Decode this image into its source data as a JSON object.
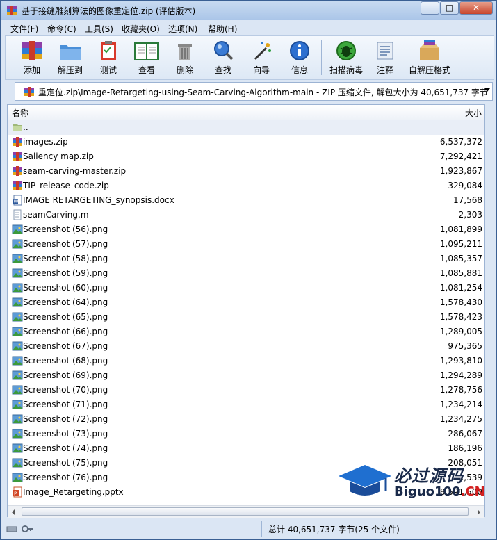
{
  "window": {
    "title": "基于接缝雕刻算法的图像重定位.zip (评估版本)",
    "controls": {
      "minimize": "–",
      "maximize": "□",
      "close": "✕"
    }
  },
  "menu": [
    "文件(F)",
    "命令(C)",
    "工具(S)",
    "收藏夹(O)",
    "选项(N)",
    "帮助(H)"
  ],
  "toolbar": [
    {
      "label": "添加",
      "icon": "add-archive-icon"
    },
    {
      "label": "解压到",
      "icon": "extract-folder-icon"
    },
    {
      "label": "测试",
      "icon": "test-clipboard-icon"
    },
    {
      "label": "查看",
      "icon": "view-book-icon"
    },
    {
      "label": "删除",
      "icon": "trash-icon"
    },
    {
      "label": "查找",
      "icon": "find-magnifier-icon"
    },
    {
      "label": "向导",
      "icon": "wizard-wand-icon"
    },
    {
      "label": "信息",
      "icon": "info-icon"
    },
    {
      "label": "扫描病毒",
      "icon": "virus-scan-icon"
    },
    {
      "label": "注释",
      "icon": "comment-icon"
    },
    {
      "label": "自解压格式",
      "icon": "sfx-box-icon"
    }
  ],
  "address": {
    "path": "重定位.zip\\Image-Retargeting-using-Seam-Carving-Algorithm-main - ZIP 压缩文件, 解包大小为 40,651,737 字节"
  },
  "columns": {
    "name": "名称",
    "size": "大小"
  },
  "files": [
    {
      "name": "..",
      "size": "",
      "type": "up"
    },
    {
      "name": "images.zip",
      "size": "6,537,372",
      "type": "zip"
    },
    {
      "name": "Saliency map.zip",
      "size": "7,292,421",
      "type": "zip"
    },
    {
      "name": "seam-carving-master.zip",
      "size": "1,923,867",
      "type": "zip"
    },
    {
      "name": "TIP_release_code.zip",
      "size": "329,084",
      "type": "zip"
    },
    {
      "name": "IMAGE RETARGETING_synopsis.docx",
      "size": "17,568",
      "type": "docx"
    },
    {
      "name": "seamCarving.m",
      "size": "2,303",
      "type": "text"
    },
    {
      "name": "Screenshot (56).png",
      "size": "1,081,899",
      "type": "png"
    },
    {
      "name": "Screenshot (57).png",
      "size": "1,095,211",
      "type": "png"
    },
    {
      "name": "Screenshot (58).png",
      "size": "1,085,357",
      "type": "png"
    },
    {
      "name": "Screenshot (59).png",
      "size": "1,085,881",
      "type": "png"
    },
    {
      "name": "Screenshot (60).png",
      "size": "1,081,254",
      "type": "png"
    },
    {
      "name": "Screenshot (64).png",
      "size": "1,578,430",
      "type": "png"
    },
    {
      "name": "Screenshot (65).png",
      "size": "1,578,423",
      "type": "png"
    },
    {
      "name": "Screenshot (66).png",
      "size": "1,289,005",
      "type": "png"
    },
    {
      "name": "Screenshot (67).png",
      "size": "975,365",
      "type": "png"
    },
    {
      "name": "Screenshot (68).png",
      "size": "1,293,810",
      "type": "png"
    },
    {
      "name": "Screenshot (69).png",
      "size": "1,294,289",
      "type": "png"
    },
    {
      "name": "Screenshot (70).png",
      "size": "1,278,756",
      "type": "png"
    },
    {
      "name": "Screenshot (71).png",
      "size": "1,234,214",
      "type": "png"
    },
    {
      "name": "Screenshot (72).png",
      "size": "1,234,275",
      "type": "png"
    },
    {
      "name": "Screenshot (73).png",
      "size": "286,067",
      "type": "png"
    },
    {
      "name": "Screenshot (74).png",
      "size": "186,196",
      "type": "png"
    },
    {
      "name": "Screenshot (75).png",
      "size": "208,051",
      "type": "png"
    },
    {
      "name": "Screenshot (76).png",
      "size": "...,539",
      "type": "png"
    },
    {
      "name": "Image_Retargeting.pptx",
      "size": "8,591,500",
      "type": "pptx"
    }
  ],
  "status": {
    "summary": "总计 40,651,737 字节(25 个文件)"
  },
  "watermark": {
    "cn": "必过源码",
    "en": "Biguo100",
    "en_suffix": ".CN"
  }
}
